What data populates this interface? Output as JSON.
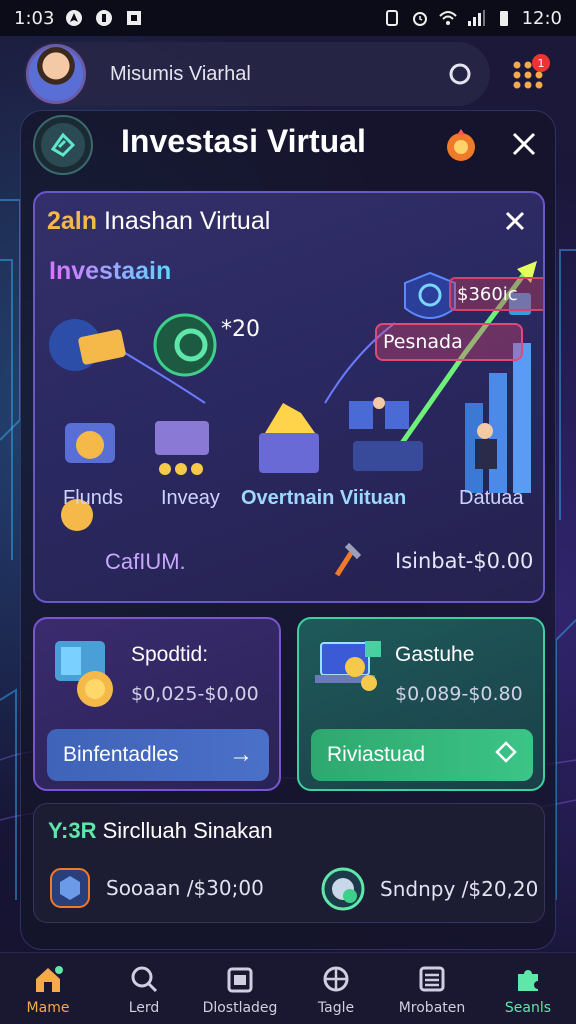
{
  "status_bar": {
    "time_left": "1:03",
    "time_right": "12:0"
  },
  "header": {
    "user_name": "Misumis Viarhal",
    "notification_count": "1"
  },
  "panel": {
    "title": "Investasi Virtual"
  },
  "invest_card": {
    "title_highlight": "2aln",
    "title_rest": " Inashan Virtual",
    "subtitle": "Investaain",
    "price_tag": "$360ic",
    "coin_amount": "*20",
    "promo_tag": "Pesnada",
    "features": [
      "Flunds",
      "Inveay",
      "Overtnain Viituan",
      "Datuaa"
    ],
    "footer_left": "CafIUM.",
    "footer_right": "Isinbat-$0.00"
  },
  "mini_cards": {
    "left": {
      "title": "Spodtid:",
      "value": "$0,025-$0,00",
      "button_label": "Binfentadles",
      "button_icon": "arrow-right-icon"
    },
    "right": {
      "title": "Gastuhe",
      "value": "$0,089-$0.80",
      "button_label": "Riviastuad",
      "button_icon": "diamond-icon"
    }
  },
  "summary": {
    "title_highlight": "Y:3R",
    "title_rest": " Sirclluah Sinakan",
    "item_left": "Sooaan /$30;00",
    "item_right": "Sndnpy /$20,20"
  },
  "bottom_nav": [
    {
      "label": "Mame",
      "icon": "home-icon"
    },
    {
      "label": "Lerd",
      "icon": "search-icon"
    },
    {
      "label": "Dlostladeg",
      "icon": "calendar-icon"
    },
    {
      "label": "Tagle",
      "icon": "globe-icon"
    },
    {
      "label": "Mrobaten",
      "icon": "list-icon"
    },
    {
      "label": "Seanls",
      "icon": "puzzle-icon"
    }
  ],
  "colors": {
    "accent_orange": "#f4a94a",
    "accent_green": "#5ee7a8",
    "accent_purple": "#7a55d0",
    "background": "#1a1640"
  }
}
